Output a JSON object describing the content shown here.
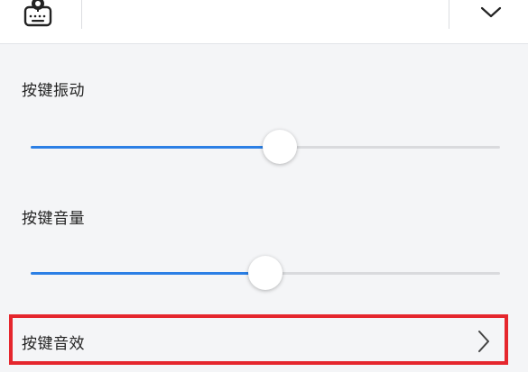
{
  "topbar": {
    "keyboard_icon": "keyboard-settings-icon",
    "dropdown_icon": "chevron-down-icon"
  },
  "settings": {
    "vibration": {
      "label": "按键振动",
      "level": 0.53
    },
    "volume": {
      "label": "按键音量",
      "level": 0.5
    },
    "sound_effect": {
      "label": "按键音效",
      "icon": "chevron-right-icon"
    }
  },
  "colors": {
    "accent": "#2b7fe5",
    "highlight_border": "#e5262d",
    "background": "#f4f5f7"
  }
}
